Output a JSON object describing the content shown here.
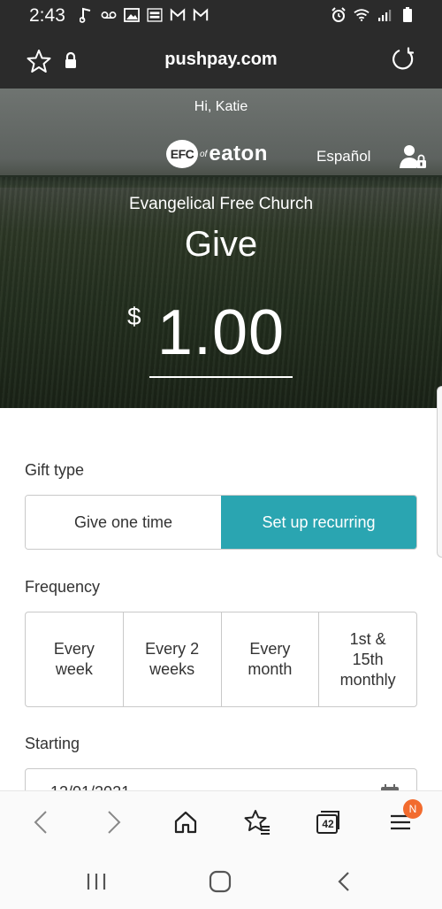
{
  "status_bar": {
    "time": "2:43",
    "left_icons": [
      "music-note-icon",
      "voicemail-icon",
      "image-icon",
      "fox-news-icon",
      "gmail-icon",
      "gmail-icon"
    ],
    "right_icons": [
      "alarm-icon",
      "wifi-icon",
      "signal-icon",
      "battery-icon"
    ]
  },
  "address_bar": {
    "url": "pushpay.com"
  },
  "hero": {
    "greeting": "Hi, Katie",
    "logo_badge": "EFC",
    "logo_of": "of",
    "logo_name": "eaton",
    "language_link": "Español",
    "church_name": "Evangelical Free Church",
    "title": "Give",
    "currency_symbol": "$",
    "amount": "1.00"
  },
  "form": {
    "gift_type_label": "Gift type",
    "gift_types": [
      "Give one time",
      "Set up recurring"
    ],
    "gift_type_selected": "Set up recurring",
    "frequency_label": "Frequency",
    "frequencies": [
      "Every\nweek",
      "Every 2\nweeks",
      "Every\nmonth",
      "1st &\n15th\nmonthly"
    ],
    "starting_label": "Starting",
    "starting_value": "12/01/2021"
  },
  "browser_toolbar": {
    "tab_count": "42",
    "notification_badge": "N"
  },
  "colors": {
    "accent": "#2aa5b1",
    "badge": "#f26b2e",
    "status_bar": "#2b2b2b"
  }
}
